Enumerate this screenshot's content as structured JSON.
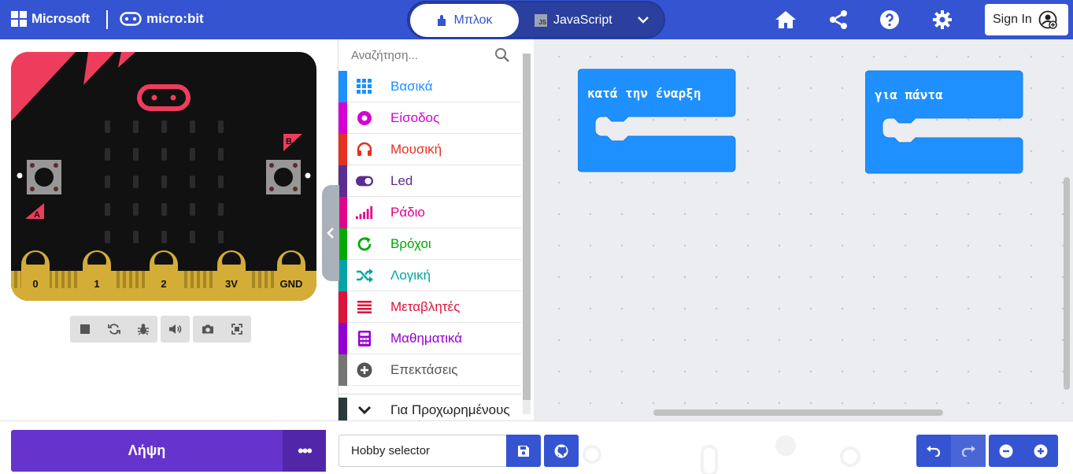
{
  "header": {
    "microsoft_label": "Microsoft",
    "product_label": "micro:bit",
    "mode_blocks_label": "Μπλοκ",
    "mode_js_label": "JavaScript",
    "js_badge": "JS",
    "signin_label": "Sign In"
  },
  "simulator": {
    "button_a": "A",
    "button_b": "B",
    "pins": [
      "0",
      "1",
      "2",
      "3V",
      "GND"
    ]
  },
  "toolbox": {
    "search_placeholder": "Αναζήτηση...",
    "categories": [
      {
        "label": "Βασικά",
        "color": "#1e90ff",
        "icon": "grid-icon"
      },
      {
        "label": "Είσοδος",
        "color": "#d400d4",
        "icon": "input-icon"
      },
      {
        "label": "Μουσική",
        "color": "#e63022",
        "icon": "headphones-icon"
      },
      {
        "label": "Led",
        "color": "#5c2d91",
        "icon": "toggle-icon"
      },
      {
        "label": "Ράδιο",
        "color": "#e3008c",
        "icon": "signal-bars-icon"
      },
      {
        "label": "Βρόχοι",
        "color": "#00aa00",
        "icon": "loop-icon"
      },
      {
        "label": "Λογική",
        "color": "#00a4a6",
        "icon": "shuffle-icon"
      },
      {
        "label": "Μεταβλητές",
        "color": "#dc143c",
        "icon": "list-icon"
      },
      {
        "label": "Μαθηματικά",
        "color": "#9400d3",
        "icon": "calculator-icon"
      },
      {
        "label": "Επεκτάσεις",
        "color": "#757575",
        "icon": "plus-circle-icon"
      }
    ],
    "advanced_label": "Για Προχωρημένους",
    "advanced_color": "#2b3a3a"
  },
  "workspace": {
    "blocks": [
      {
        "label": "κατά την έναρξη"
      },
      {
        "label": "για πάντα"
      }
    ],
    "block_color": "#1e90ff"
  },
  "bottom": {
    "download_label": "Λήψη",
    "more_label": "•••",
    "project_name": "Hobby selector"
  },
  "colors": {
    "topbar": "#3454d1",
    "download": "#6633cc",
    "accent": "#3454d1"
  }
}
